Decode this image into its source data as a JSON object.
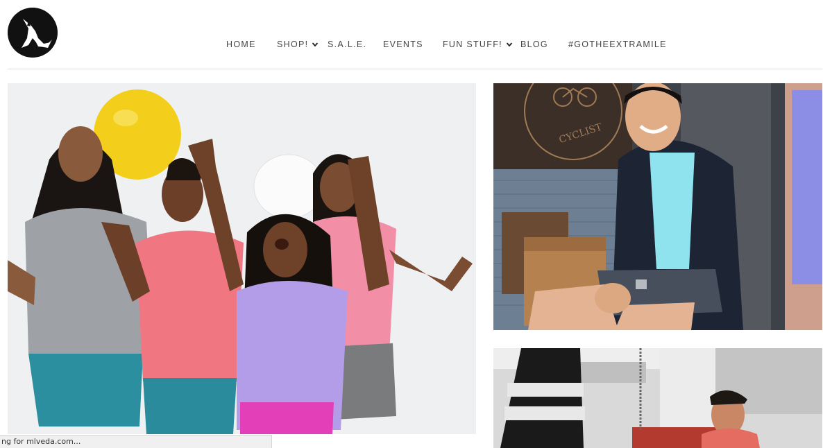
{
  "site": {
    "logo_icon": "fox-logo-icon"
  },
  "nav": {
    "items": [
      {
        "label": "HOME",
        "has_dropdown": false
      },
      {
        "label": "SHOP!",
        "has_dropdown": true
      },
      {
        "label": "S.A.L.E.",
        "has_dropdown": false
      },
      {
        "label": "EVENTS",
        "has_dropdown": false
      },
      {
        "label": "FUN STUFF!",
        "has_dropdown": true
      },
      {
        "label": "BLOG",
        "has_dropdown": false
      },
      {
        "label": "#GOTHEEXTRAMILE",
        "has_dropdown": false
      }
    ],
    "dropdown_icon": "chevron-down-icon"
  },
  "photos": {
    "main": {
      "subject": "kids-with-balloons-photo"
    },
    "right_top": {
      "subject": "smiling-man-cafe-photo",
      "wall_sign_text": "CYCLIST"
    },
    "right_bottom": {
      "subject": "boxing-gym-photo"
    }
  },
  "status_bar": {
    "text": "ng for mlveda.com..."
  },
  "colors": {
    "nav_text": "#444444",
    "header_rule": "#cfe3e3",
    "logo_bg": "#111111"
  }
}
